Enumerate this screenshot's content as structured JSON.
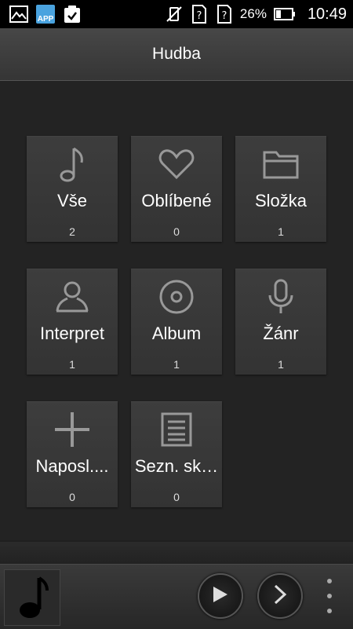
{
  "status_bar": {
    "app_badge": "APP",
    "battery": "26%",
    "time": "10:49",
    "icons": [
      "gallery-icon",
      "app-store-icon",
      "clipboard-check-icon",
      "vibrate-off-icon",
      "sim-unknown-icon",
      "sim-unknown-icon",
      "battery-icon"
    ]
  },
  "header": {
    "title": "Hudba"
  },
  "categories": [
    {
      "label": "Vše",
      "count": "2",
      "icon": "music-note-icon"
    },
    {
      "label": "Oblíbené",
      "count": "0",
      "icon": "heart-icon"
    },
    {
      "label": "Složka",
      "count": "1",
      "icon": "folder-icon"
    },
    {
      "label": "Interpret",
      "count": "1",
      "icon": "artist-icon"
    },
    {
      "label": "Album",
      "count": "1",
      "icon": "disc-icon"
    },
    {
      "label": "Žánr",
      "count": "1",
      "icon": "microphone-icon"
    },
    {
      "label": "Naposl....",
      "count": "0",
      "icon": "plus-icon"
    },
    {
      "label": "Sezn. sk…",
      "count": "0",
      "icon": "playlist-icon"
    }
  ],
  "player": {
    "icons": [
      "album-art-icon",
      "play-icon",
      "next-icon",
      "overflow-menu-icon"
    ]
  },
  "colors": {
    "background": "#232323",
    "titlebar": "#3d3d3d",
    "tile": "#383838",
    "icon": "#9a9a9a"
  }
}
